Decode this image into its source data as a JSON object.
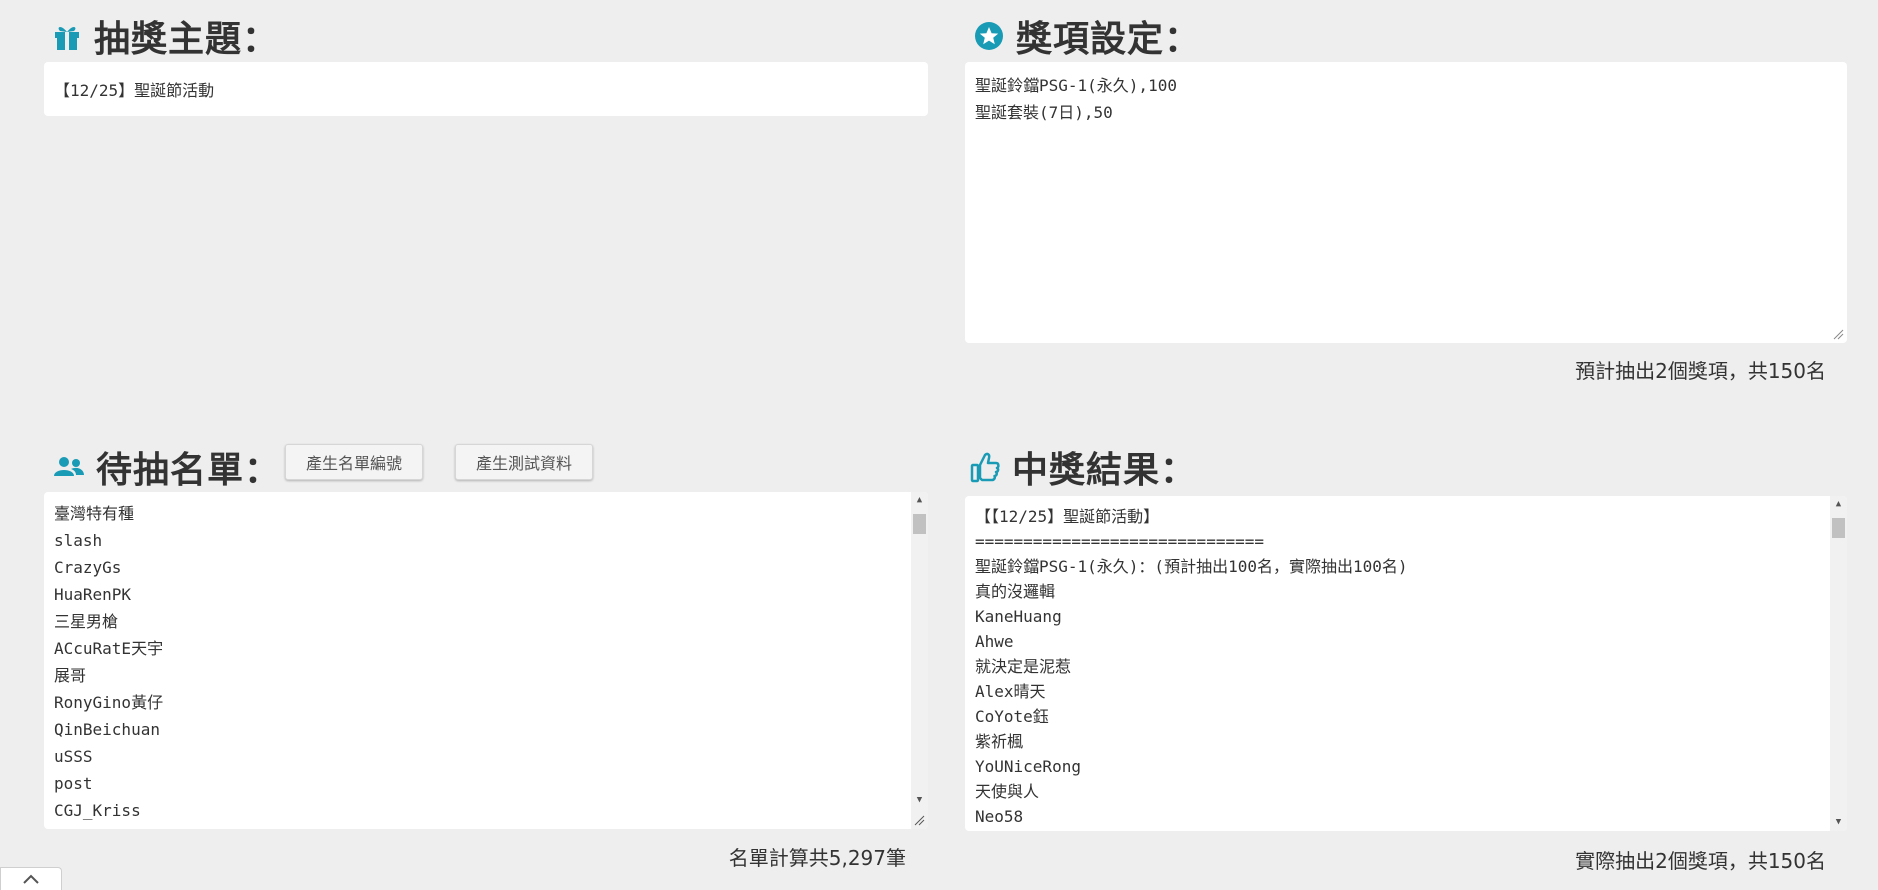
{
  "topic": {
    "heading": "抽獎主題：",
    "icon": "gift-icon",
    "value": "【12/25】聖誕節活動"
  },
  "prizes": {
    "heading": "獎項設定：",
    "icon": "star-icon",
    "lines": [
      "聖誕鈴鐺PSG-1(永久),100",
      "聖誕套裝(7日),50"
    ],
    "summary": "預計抽出2個獎項，共150名"
  },
  "candidates": {
    "heading": "待抽名單：",
    "icon": "users-icon",
    "buttons": {
      "generate_numbers": "產生名單編號",
      "generate_test_data": "產生測試資料"
    },
    "names": [
      "臺灣特有種",
      "slash",
      "CrazyGs",
      "HuaRenPK",
      "三星男槍",
      "ACcuRatE天宇",
      "展哥",
      "RonyGino黃仔",
      "QinBeichuan",
      "uSSS",
      "post",
      "CGJ_Kriss"
    ],
    "summary": "名單計算共5,297筆"
  },
  "results": {
    "heading": "中獎結果：",
    "icon": "thumbs-up-icon",
    "lines": [
      "【【12/25】聖誕節活動】",
      "==============================",
      "聖誕鈴鐺PSG-1(永久)：(預計抽出100名，實際抽出100名)",
      "真的沒邏輯",
      "KaneHuang",
      "Ahwe",
      "就決定是泥惹",
      "Alex晴天",
      "CoYote鈺",
      "紫祈楓",
      "YoUNiceRong",
      "天使與人",
      "Neo58"
    ],
    "summary": "實際抽出2個獎項，共150名"
  },
  "colors": {
    "accent": "#1a9bb5",
    "background": "#eeeeee",
    "panel": "#ffffff"
  }
}
